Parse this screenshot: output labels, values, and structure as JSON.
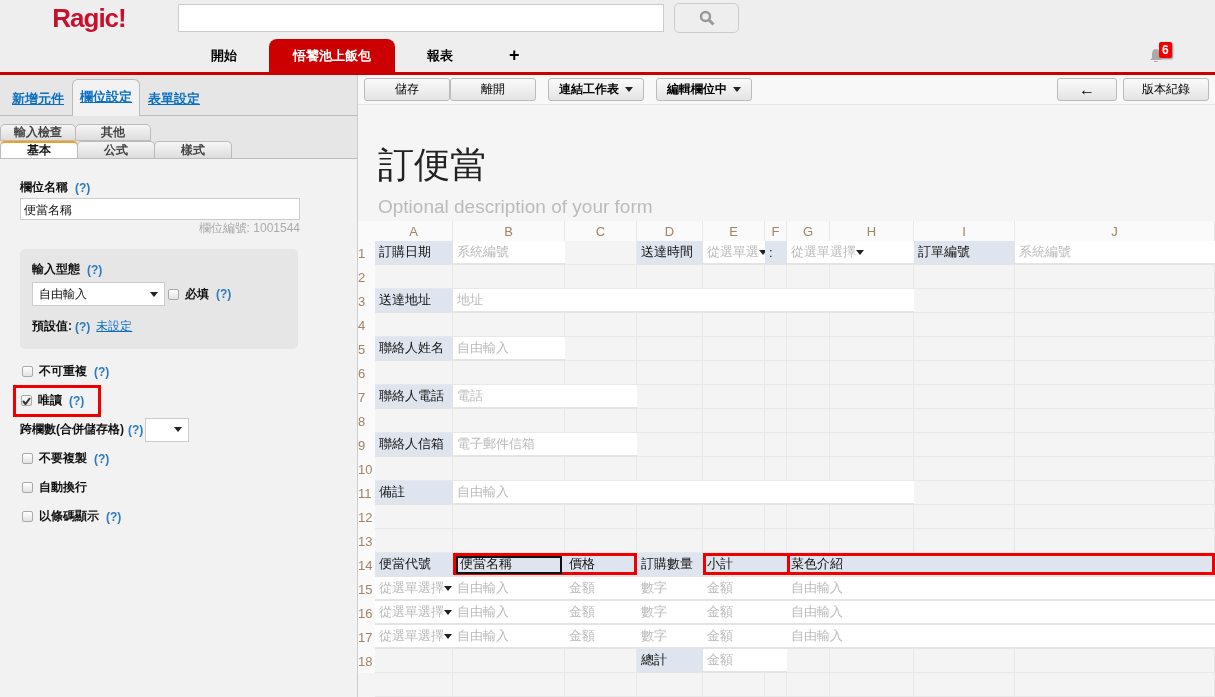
{
  "header": {
    "logo": "Ragic!",
    "notifications": "6"
  },
  "nav": [
    {
      "label": "開始",
      "selected": false
    },
    {
      "label": "悟饕池上飯包",
      "selected": true
    },
    {
      "label": "報表",
      "selected": false
    },
    {
      "label": "+",
      "selected": false
    }
  ],
  "panel": {
    "tabs": [
      {
        "label": "新增元件",
        "selected": false
      },
      {
        "label": "欄位設定",
        "selected": true
      },
      {
        "label": "表單設定",
        "selected": false
      }
    ],
    "subtabs_back": [
      {
        "label": "輸入檢查",
        "selected": false
      },
      {
        "label": "其他",
        "selected": false
      }
    ],
    "subtabs_front": [
      {
        "label": "基本",
        "selected": true
      },
      {
        "label": "公式",
        "selected": false
      },
      {
        "label": "樣式",
        "selected": false
      }
    ],
    "field_name": {
      "label": "欄位名稱",
      "help": "(?)",
      "value": "便當名稱",
      "field_id": "欄位編號: 1001544"
    },
    "input_type": {
      "label": "輸入型態",
      "help": "(?)",
      "value": "自由輸入",
      "required": {
        "label": "必填",
        "help": "(?)",
        "checked": false
      },
      "default": {
        "label": "預設值:",
        "help": "(?)",
        "link": "未設定"
      }
    },
    "options": [
      {
        "kind": "checkbox",
        "label": "不可重複",
        "help": "(?)",
        "checked": false,
        "highlighted": false
      },
      {
        "kind": "checkbox",
        "label": "唯讀",
        "help": "(?)",
        "checked": true,
        "highlighted": true
      },
      {
        "kind": "select",
        "label": "跨欄數(合併儲存格)",
        "help": "(?)"
      },
      {
        "kind": "checkbox",
        "label": "不要複製",
        "help": "(?)",
        "checked": false,
        "highlighted": false
      },
      {
        "kind": "checkbox",
        "label": "自動換行",
        "checked": false,
        "highlighted": false
      },
      {
        "kind": "checkbox",
        "label": "以條碼顯示",
        "help": "(?)",
        "checked": false,
        "highlighted": false
      }
    ]
  },
  "toolbar": {
    "left": [
      {
        "label": "儲存",
        "kind": "plain"
      },
      {
        "label": "離開",
        "kind": "plain"
      },
      {
        "label": "連結工作表",
        "kind": "menu"
      },
      {
        "label": "編輯欄位中",
        "kind": "menu"
      }
    ],
    "right": [
      {
        "label": "←"
      },
      {
        "label": "版本紀錄"
      }
    ]
  },
  "form": {
    "title": "訂便當",
    "description": {
      "placeholder": "Optional description of your form"
    }
  },
  "sheet": {
    "columns": [
      "A",
      "B",
      "C",
      "D",
      "E",
      "F",
      "G",
      "H",
      "I",
      "J"
    ],
    "rows": [
      {
        "number": "1",
        "cells": [
          {
            "kind": "label",
            "text": "訂購日期",
            "selected": false
          },
          {
            "kind": "field",
            "text": "系統編號",
            "selected": false
          },
          {
            "kind": "blank",
            "selected": false
          },
          {
            "kind": "label",
            "text": "送達時間",
            "selected": false
          },
          {
            "kind": "dropdown",
            "text": "從選單選",
            "selected": false
          },
          {
            "kind": "label",
            "text": ":",
            "selected": false
          },
          {
            "kind": "dropdown",
            "text": "從選單選擇",
            "selected": false
          },
          {
            "kind": "dropdown"
          },
          {
            "kind": "label",
            "text": "訂單編號",
            "selected": false
          },
          {
            "kind": "field",
            "text": "系統編號",
            "selected": false
          }
        ]
      },
      {
        "number": "2"
      },
      {
        "number": "3",
        "cells": [
          {
            "kind": "label",
            "text": "送達地址",
            "selected": false
          },
          {
            "kind": "field",
            "text": "地址",
            "selected": false
          },
          {
            "kind": "field"
          },
          {
            "kind": "field"
          },
          {
            "kind": "field"
          },
          {
            "kind": "field"
          },
          {
            "kind": "field"
          },
          {
            "kind": "field"
          }
        ]
      },
      {
        "number": "4"
      },
      {
        "number": "5",
        "cells": [
          {
            "kind": "label",
            "text": "聯絡人姓名",
            "selected": false
          },
          {
            "kind": "field",
            "text": "自由輸入",
            "selected": false
          }
        ]
      },
      {
        "number": "6"
      },
      {
        "number": "7",
        "cells": [
          {
            "kind": "label",
            "text": "聯絡人電話",
            "selected": false
          },
          {
            "kind": "field",
            "text": "電話",
            "selected": false
          },
          {
            "kind": "field"
          }
        ]
      },
      {
        "number": "8"
      },
      {
        "number": "9",
        "cells": [
          {
            "kind": "label",
            "text": "聯絡人信箱",
            "selected": false
          },
          {
            "kind": "field",
            "text": "電子郵件信箱",
            "selected": false
          },
          {
            "kind": "field"
          }
        ]
      },
      {
        "number": "10"
      },
      {
        "number": "11",
        "cells": [
          {
            "kind": "label",
            "text": "備註",
            "selected": false
          },
          {
            "kind": "field",
            "text": "自由輸入",
            "selected": false
          },
          {
            "kind": "field"
          },
          {
            "kind": "field"
          },
          {
            "kind": "field"
          },
          {
            "kind": "field"
          },
          {
            "kind": "field"
          },
          {
            "kind": "field"
          }
        ]
      },
      {
        "number": "12"
      },
      {
        "number": "13"
      },
      {
        "number": "14",
        "cells": [
          {
            "kind": "label",
            "text": "便當代號",
            "selected": false,
            "framed": false
          },
          {
            "kind": "label",
            "text": "便當名稱",
            "selected": true,
            "framed": true
          },
          {
            "kind": "label",
            "text": "價格",
            "selected": false,
            "framed": true
          },
          {
            "kind": "label",
            "text": "訂購數量",
            "selected": false,
            "framed": false
          },
          {
            "kind": "label",
            "text": "小計",
            "selected": false,
            "framed": true
          },
          {
            "kind": "label"
          },
          {
            "kind": "label",
            "text": "菜色介紹",
            "selected": false,
            "framed": true
          },
          {
            "kind": "label"
          },
          {
            "kind": "label"
          },
          {
            "kind": "label"
          }
        ]
      },
      {
        "number": "15",
        "cells": [
          {
            "kind": "dropdown",
            "text": "從選單選擇",
            "selected": false
          },
          {
            "kind": "field",
            "text": "自由輸入",
            "selected": false
          },
          {
            "kind": "field",
            "text": "金額",
            "selected": false
          },
          {
            "kind": "field",
            "text": "數字",
            "selected": false
          },
          {
            "kind": "field",
            "text": "金額",
            "selected": false
          },
          {
            "kind": "field"
          },
          {
            "kind": "field",
            "text": "自由輸入",
            "selected": false
          },
          {
            "kind": "field"
          },
          {
            "kind": "field"
          },
          {
            "kind": "field"
          }
        ]
      },
      {
        "number": "16",
        "cells": [
          {
            "kind": "dropdown",
            "text": "從選單選擇",
            "selected": false
          },
          {
            "kind": "field",
            "text": "自由輸入",
            "selected": false
          },
          {
            "kind": "field",
            "text": "金額",
            "selected": false
          },
          {
            "kind": "field",
            "text": "數字",
            "selected": false
          },
          {
            "kind": "field",
            "text": "金額",
            "selected": false
          },
          {
            "kind": "field"
          },
          {
            "kind": "field",
            "text": "自由輸入",
            "selected": false
          },
          {
            "kind": "field"
          },
          {
            "kind": "field"
          },
          {
            "kind": "field"
          }
        ]
      },
      {
        "number": "17",
        "cells": [
          {
            "kind": "dropdown",
            "text": "從選單選擇",
            "selected": false
          },
          {
            "kind": "field",
            "text": "自由輸入",
            "selected": false
          },
          {
            "kind": "field",
            "text": "金額",
            "selected": false
          },
          {
            "kind": "field",
            "text": "數字",
            "selected": false
          },
          {
            "kind": "field",
            "text": "金額",
            "selected": false
          },
          {
            "kind": "field"
          },
          {
            "kind": "field",
            "text": "自由輸入",
            "selected": false
          },
          {
            "kind": "field"
          },
          {
            "kind": "field"
          },
          {
            "kind": "field"
          }
        ]
      },
      {
        "number": "18",
        "cells": [
          {
            "kind": "blank",
            "selected": false
          },
          {
            "kind": "blank",
            "selected": false
          },
          {
            "kind": "blank",
            "selected": false
          },
          {
            "kind": "label",
            "text": "總計",
            "selected": false
          },
          {
            "kind": "field",
            "text": "金額",
            "selected": false
          },
          {
            "kind": "field"
          }
        ]
      }
    ]
  }
}
